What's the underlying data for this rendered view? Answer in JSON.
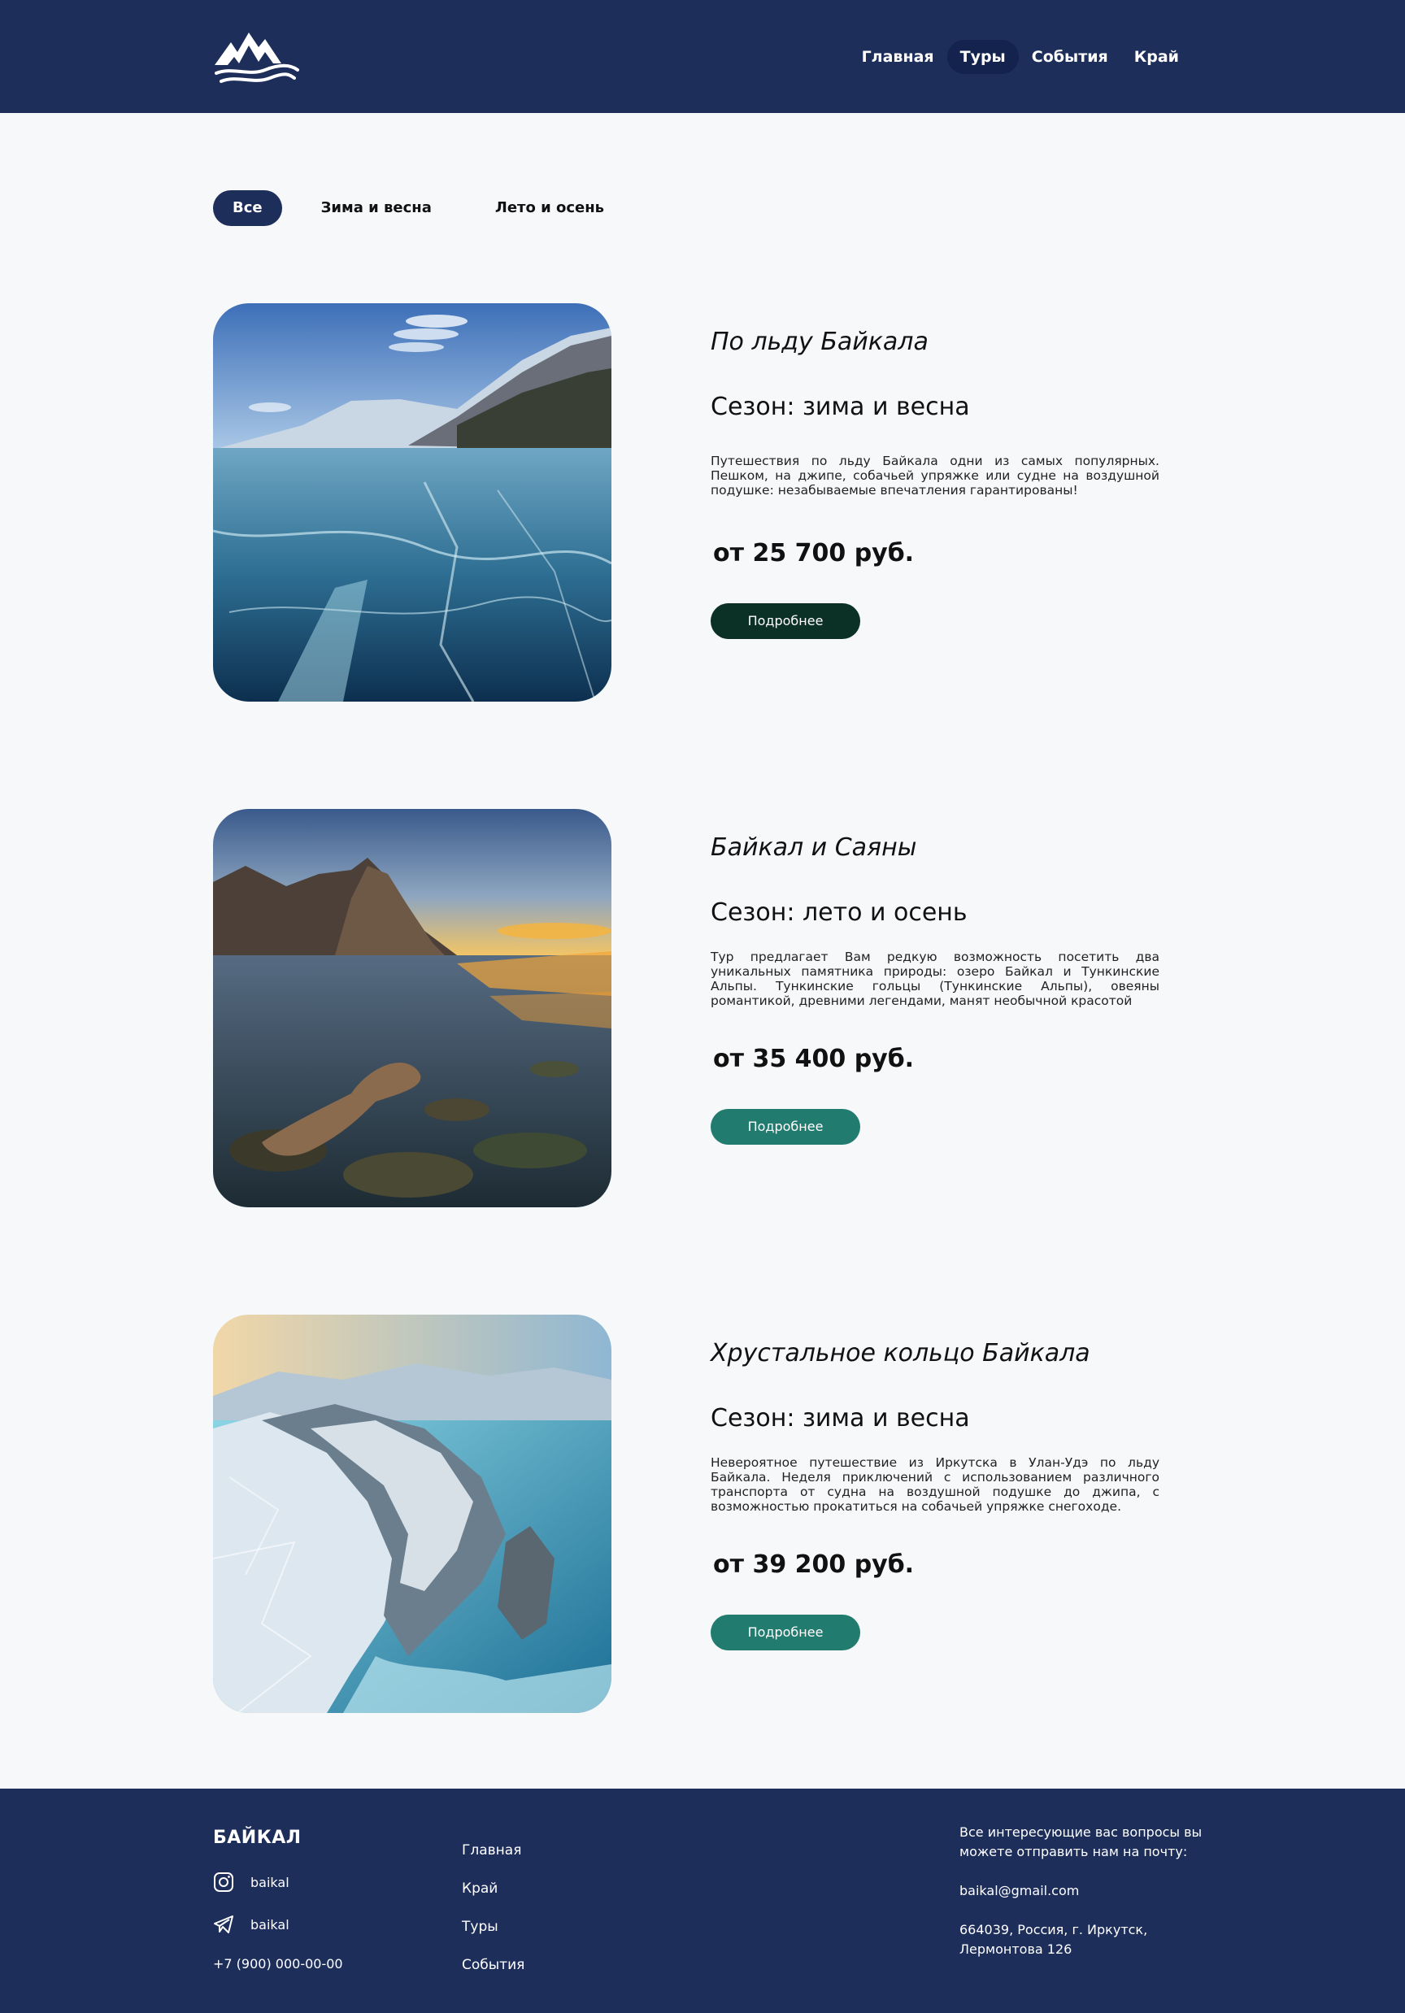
{
  "header": {
    "logo": "mountain-wave-logo",
    "nav": [
      {
        "label": "Главная",
        "active": false
      },
      {
        "label": "Туры",
        "active": true
      },
      {
        "label": "События",
        "active": false
      },
      {
        "label": "Край",
        "active": false
      }
    ]
  },
  "filters": [
    {
      "label": "Все",
      "active": true
    },
    {
      "label": "Зима и весна",
      "active": false
    },
    {
      "label": "Лето и осень",
      "active": false
    }
  ],
  "tours": [
    {
      "title": "По льду Байкала",
      "season": "Сезон: зима и весна",
      "description": "Путешествия по льду Байкала одни из самых популярных. Пешком, на джипе, собачьей упряжке или судне на воздушной подушке: незабываемые впечатления гарантированы!",
      "price": "от 25 700 руб.",
      "button": "Подробнее",
      "image": "frozen-lake-baikal-ice"
    },
    {
      "title": "Байкал и Саяны",
      "season": "Сезон: лето и осень",
      "description": "Тур предлагает Вам редкую возможность посетить два уникальных памятника природы: озеро Байкал и Тункинские Альпы. Тункинские гольцы (Тункинские Альпы), овеяны романтикой, древними легендами, манят необычной красотой",
      "price": "от 35 400 руб.",
      "button": "Подробнее",
      "image": "baikal-sunset-shaman-rock"
    },
    {
      "title": "Хрустальное кольцо Байкала",
      "season": "Сезон: зима и весна",
      "description": "Невероятное путешествие из Иркутска в Улан-Удэ по льду Байкала. Неделя приключений с использованием различного транспорта от судна на воздушной подушке до джипа, с возможностью прокатиться на собачьей упряжке снегоходе.",
      "price": "от 39 200 руб.",
      "button": "Подробнее",
      "image": "winter-cliffs-aerial"
    }
  ],
  "footer": {
    "brand": "БАЙКАЛ",
    "instagram": "baikal",
    "telegram": "baikal",
    "phone": "+7 (900) 000-00-00",
    "links": [
      "Главная",
      "Край",
      "Туры",
      "События"
    ],
    "contact_text": "Все интересующие вас вопросы вы можете отправить нам на почту:",
    "email": "baikal@gmail.com",
    "address": "664039, Россия, г. Иркутск, Лермонтова 126"
  },
  "colors": {
    "primary": "#1d2e5b",
    "background": "#f6f8fa",
    "button_teal": "#227b6f",
    "button_dark": "#0b3127"
  }
}
